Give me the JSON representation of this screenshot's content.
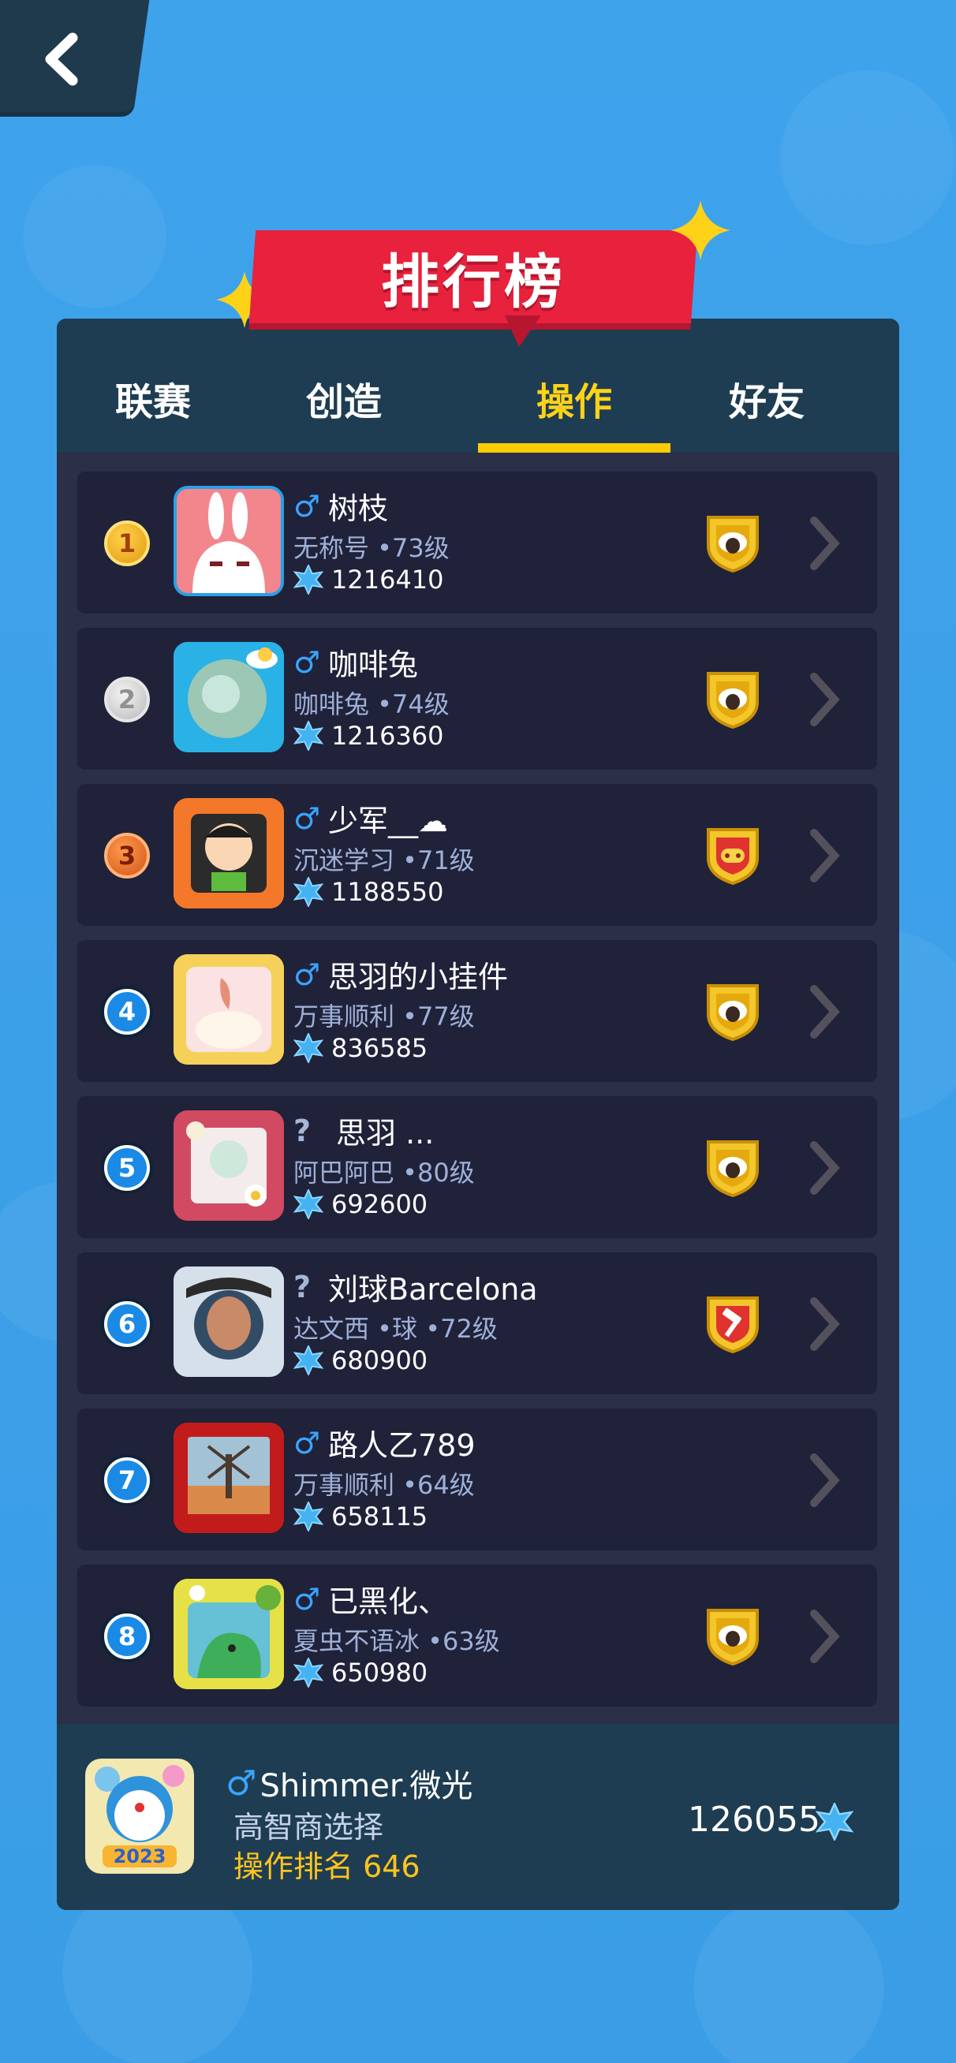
{
  "title": "排行榜",
  "tabs": [
    {
      "label": "联赛",
      "active": false
    },
    {
      "label": "创造",
      "active": false
    },
    {
      "label": "操作",
      "active": true
    },
    {
      "label": "好友",
      "active": false
    }
  ],
  "players": [
    {
      "rank": "1",
      "gender": "male",
      "name": "树枝",
      "sub": "无称号 •73级",
      "score": "1216410",
      "badge": "sheep-shield-icon"
    },
    {
      "rank": "2",
      "gender": "male",
      "name": "咖啡兔",
      "sub": "咖啡兔 •74级",
      "score": "1216360",
      "badge": "sheep-shield-icon"
    },
    {
      "rank": "3",
      "gender": "male",
      "name": "少军__☁",
      "sub": "沉迷学习 •71级",
      "score": "1188550",
      "badge": "gamepad-shield-icon"
    },
    {
      "rank": "4",
      "gender": "male",
      "name": "思羽的小挂件",
      "sub": "万事顺利 •77级",
      "score": "836585",
      "badge": "sheep-shield-icon"
    },
    {
      "rank": "5",
      "gender": "unknown",
      "name": "思羽 ...",
      "sub": "阿巴阿巴 •80级",
      "score": "692600",
      "badge": "sheep-shield-icon"
    },
    {
      "rank": "6",
      "gender": "unknown",
      "name": "刘球Barcelona",
      "sub": "达文西 •球 •72级",
      "score": "680900",
      "badge": "hammer-shield-icon"
    },
    {
      "rank": "7",
      "gender": "male",
      "name": "路人乙789",
      "sub": "万事顺利 •64级",
      "score": "658115",
      "badge": ""
    },
    {
      "rank": "8",
      "gender": "male",
      "name": "已黑化、",
      "sub": "夏虫不语冰 •63级",
      "score": "650980",
      "badge": "sheep-shield-icon"
    }
  ],
  "gender_symbols": {
    "male": "♂",
    "unknown": "?"
  },
  "me": {
    "gender": "♂",
    "name": "Shimmer.微光",
    "sub": "高智商选择",
    "rank_text": "操作排名 646",
    "score": "126055"
  },
  "colors": {
    "background": "#3ea2ea",
    "panel": "#2b2f47",
    "row": "#1f2239",
    "tab_active": "#ffd21a",
    "banner": "#e8213d",
    "male": "#3aa4ff"
  }
}
